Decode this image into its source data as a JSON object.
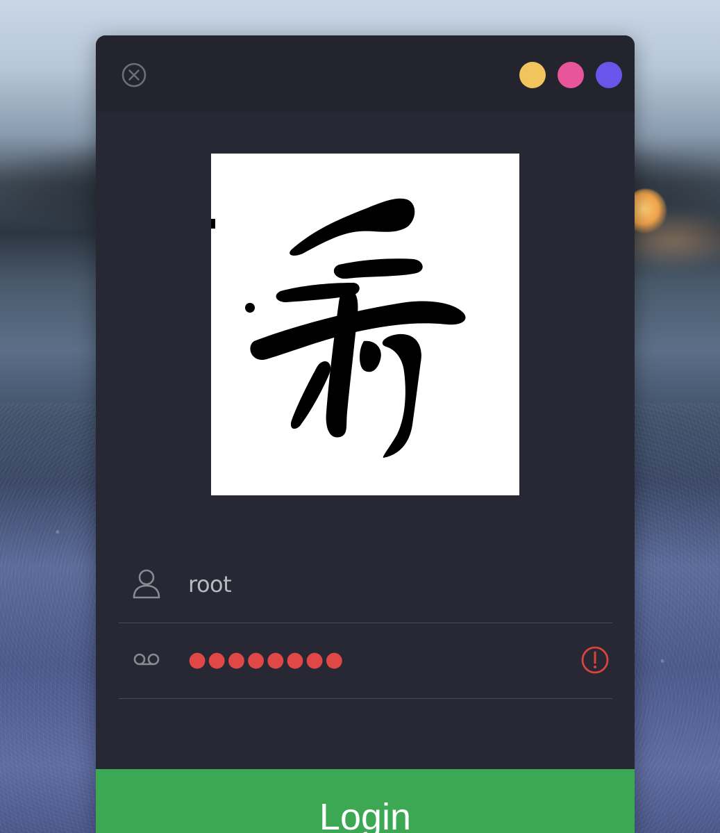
{
  "titlebar": {
    "close_icon": "close-circle-icon",
    "dots": [
      {
        "color": "#f2c45e"
      },
      {
        "color": "#e9559a"
      },
      {
        "color": "#6a55ea"
      }
    ]
  },
  "logo": {
    "glyph": "秀"
  },
  "form": {
    "username": {
      "icon": "user-icon",
      "value": "root"
    },
    "password": {
      "icon": "voicemail-icon",
      "value": "●●●●●●●●",
      "status_icon": "warning-circle-icon",
      "status_color": "#d9443c"
    }
  },
  "login": {
    "label": "Login",
    "color": "#3da853"
  }
}
